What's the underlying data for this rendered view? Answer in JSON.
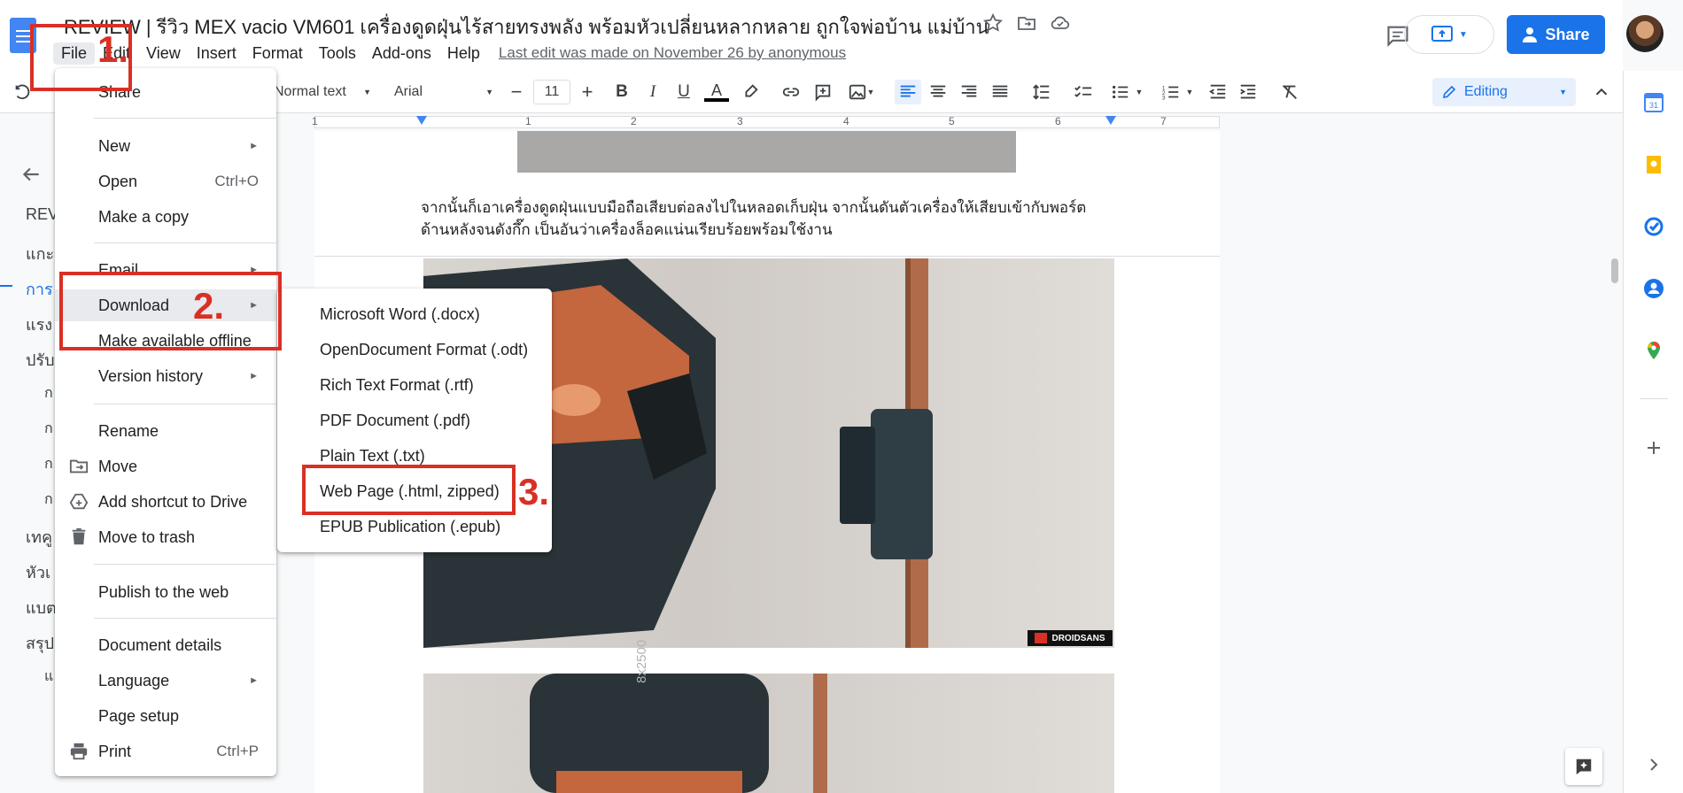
{
  "header": {
    "title": "REVIEW | รีวิว MEX vacio VM601 เครื่องดูดฝุ่นไร้สายทรงพลัง พร้อมหัวเปลี่ยนหลากหลาย ถูกใจพ่อบ้าน แม่บ้าน",
    "menus": [
      "File",
      "Edit",
      "View",
      "Insert",
      "Format",
      "Tools",
      "Add-ons",
      "Help"
    ],
    "last_edit": "Last edit was made on November 26 by anonymous",
    "share_label": "Share",
    "brand_color": "#1a73e8"
  },
  "toolbar": {
    "style": "Normal text",
    "font": "Arial",
    "font_size": "11",
    "mode": "Editing"
  },
  "ruler": {
    "numbers": [
      "1",
      "1",
      "2",
      "3",
      "4",
      "5",
      "6",
      "7"
    ]
  },
  "outline": {
    "items": [
      "REV",
      "แกะ",
      "การ",
      "แรง",
      "ปรับ",
      "ก",
      "ก",
      "ก",
      "ก",
      "เทคู",
      "หัวเ",
      "แบต",
      "สรุป",
      "แ"
    ]
  },
  "document": {
    "paragraph_line1": "จากนั้นก็เอาเครื่องดูดฝุ่นแบบมือถือเสียบต่อลงไปในหลอดเก็บฝุ่น จากนั้นดันตัวเครื่องให้เสียบเข้ากับพอร์ต",
    "paragraph_line2": "ด้านหลังจนดังกึ๊ก เป็นอันว่าเครื่องล็อคแน่นเรียบร้อยพร้อมใช้งาน",
    "watermark": "DROIDSANS",
    "product_text": "8x2500"
  },
  "file_menu": {
    "share": "Share",
    "new": "New",
    "open": "Open",
    "open_shortcut": "Ctrl+O",
    "make_copy": "Make a copy",
    "email": "Email",
    "download": "Download",
    "make_offline": "Make available offline",
    "version_history": "Version history",
    "rename": "Rename",
    "move": "Move",
    "add_shortcut": "Add shortcut to Drive",
    "move_trash": "Move to trash",
    "publish": "Publish to the web",
    "details": "Document details",
    "language": "Language",
    "page_setup": "Page setup",
    "print": "Print",
    "print_shortcut": "Ctrl+P",
    "arrow": "►"
  },
  "download_menu": {
    "items": [
      "Microsoft Word (.docx)",
      "OpenDocument Format (.odt)",
      "Rich Text Format (.rtf)",
      "PDF Document (.pdf)",
      "Plain Text (.txt)",
      "Web Page (.html, zipped)",
      "EPUB Publication (.epub)"
    ]
  },
  "annotations": {
    "step1": "1.",
    "step2": "2.",
    "step3": "3.",
    "color": "#d93025"
  }
}
